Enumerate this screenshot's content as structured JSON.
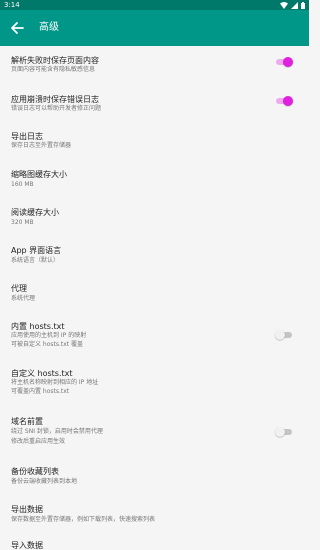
{
  "status_bar": {
    "time": "3:14",
    "icons": [
      "wifi-icon",
      "signal-icon",
      "battery-icon"
    ]
  },
  "app_bar": {
    "title": "高级",
    "back_icon": "arrow-back-icon"
  },
  "colors": {
    "primary": "#009688",
    "primary_dark": "#00796b",
    "switch_on": "#e01fdf",
    "switch_off": "#c4c4c4"
  },
  "settings": [
    {
      "title": "解析失败时保存页面内容",
      "summary": [
        "页面内容可能含有隐私敏感信息"
      ],
      "switch": true,
      "checked": true
    },
    {
      "title": "应用崩溃时保存错误日志",
      "summary": [
        "错误日志可以帮助开发者修正问题"
      ],
      "switch": true,
      "checked": true
    },
    {
      "title": "导出日志",
      "summary": [
        "保存日志至外置存储器"
      ],
      "switch": false
    },
    {
      "title": "缩略图缓存大小",
      "summary": [
        "160 MB"
      ],
      "switch": false
    },
    {
      "title": "阅读缓存大小",
      "summary": [
        "320 MB"
      ],
      "switch": false
    },
    {
      "title": "App 界面语言",
      "summary": [
        "系统语言（默认）"
      ],
      "switch": false
    },
    {
      "title": "代理",
      "summary": [
        "系统代理"
      ],
      "switch": false
    },
    {
      "title": "内置 hosts.txt",
      "summary": [
        "应用使用的主机到 IP 的映射",
        "可被自定义 hosts.txt 覆盖"
      ],
      "switch": true,
      "checked": false
    },
    {
      "title": "自定义 hosts.txt",
      "summary": [
        "将主机名称映射到相应的 IP 地址",
        "可覆盖内置 hosts.txt"
      ],
      "switch": false
    },
    {
      "title": "域名前置",
      "summary": [
        "绕过 SNI 封锁，启用时会禁用代理",
        "修改后重启应用生效"
      ],
      "switch": true,
      "checked": false
    },
    {
      "title": "备份收藏列表",
      "summary": [
        "备份云端收藏列表到本地"
      ],
      "switch": false
    },
    {
      "title": "导出数据",
      "summary": [
        "保存数据至外置存储器，例如下载列表，快速搜索列表"
      ],
      "switch": false
    },
    {
      "title": "导入数据",
      "summary": [],
      "switch": false
    }
  ]
}
